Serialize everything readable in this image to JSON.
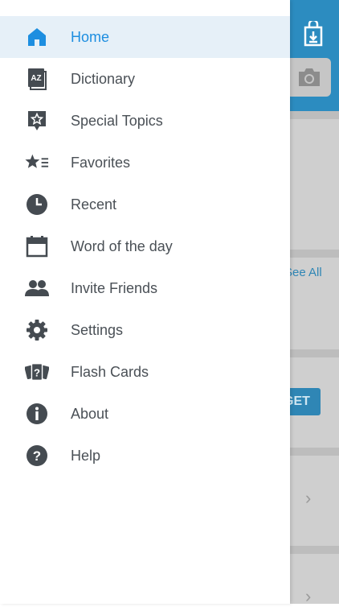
{
  "background": {
    "see_all_label": "See All",
    "get_button_label": "GET",
    "chevron_glyph": "›",
    "icons": [
      "download-icon",
      "camera-icon"
    ]
  },
  "drawer": {
    "items": [
      {
        "label": "Home",
        "icon": "home-icon",
        "active": true
      },
      {
        "label": "Dictionary",
        "icon": "dictionary-icon",
        "active": false
      },
      {
        "label": "Special Topics",
        "icon": "special-topics-icon",
        "active": false
      },
      {
        "label": "Favorites",
        "icon": "favorites-icon",
        "active": false
      },
      {
        "label": "Recent",
        "icon": "clock-icon",
        "active": false
      },
      {
        "label": "Word of the day",
        "icon": "calendar-icon",
        "active": false
      },
      {
        "label": "Invite Friends",
        "icon": "people-icon",
        "active": false
      },
      {
        "label": "Settings",
        "icon": "gear-icon",
        "active": false
      },
      {
        "label": "Flash Cards",
        "icon": "flash-cards-icon",
        "active": false
      },
      {
        "label": "About",
        "icon": "info-icon",
        "active": false
      },
      {
        "label": "Help",
        "icon": "help-icon",
        "active": false
      }
    ]
  },
  "colors": {
    "accent": "#1d8ee0",
    "active_row": "#e6f0f8",
    "icon": "#454b51",
    "header": "#2c8cc0"
  }
}
